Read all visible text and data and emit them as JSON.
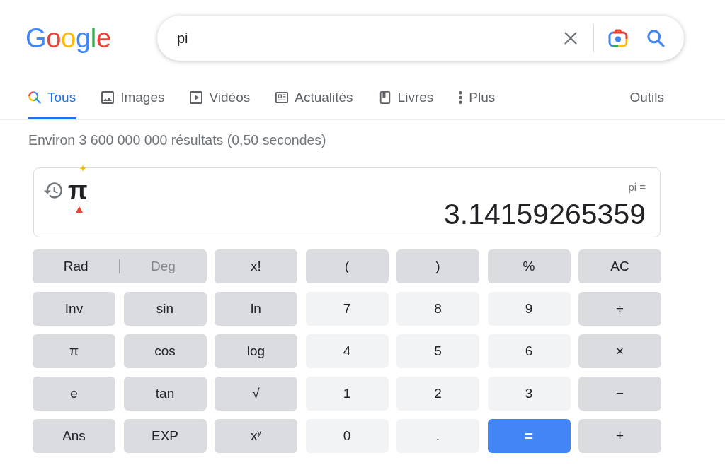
{
  "logo": "Google",
  "search": {
    "value": "pi"
  },
  "tabs": [
    {
      "label": "Tous",
      "kind": "search",
      "selected": true
    },
    {
      "label": "Images",
      "kind": "image",
      "selected": false
    },
    {
      "label": "Vidéos",
      "kind": "video",
      "selected": false
    },
    {
      "label": "Actualités",
      "kind": "news",
      "selected": false
    },
    {
      "label": "Livres",
      "kind": "book",
      "selected": false
    },
    {
      "label": "Plus",
      "kind": "more",
      "selected": false
    }
  ],
  "tools": "Outils",
  "result_stats": "Environ 3 600 000 000 résultats (0,50 secondes)",
  "calculator": {
    "expression": "π",
    "equation": "pi =",
    "result": "3.14159265359",
    "keys": [
      [
        {
          "kind": "toggle",
          "options": [
            {
              "label": "Rad",
              "selected": true
            },
            {
              "label": "Deg",
              "selected": false
            }
          ]
        },
        {
          "kind": "function",
          "label": "x!"
        },
        {
          "kind": "function",
          "label": "("
        },
        {
          "kind": "function",
          "label": ")"
        },
        {
          "kind": "function",
          "label": "%"
        },
        {
          "kind": "function",
          "label": "AC"
        }
      ],
      [
        {
          "kind": "function",
          "label": "Inv"
        },
        {
          "kind": "function",
          "label": "sin"
        },
        {
          "kind": "function",
          "label": "ln"
        },
        {
          "kind": "digit",
          "label": "7"
        },
        {
          "kind": "digit",
          "label": "8"
        },
        {
          "kind": "digit",
          "label": "9"
        },
        {
          "kind": "function",
          "label": "÷"
        }
      ],
      [
        {
          "kind": "function",
          "label": "π"
        },
        {
          "kind": "function",
          "label": "cos"
        },
        {
          "kind": "function",
          "label": "log"
        },
        {
          "kind": "digit",
          "label": "4"
        },
        {
          "kind": "digit",
          "label": "5"
        },
        {
          "kind": "digit",
          "label": "6"
        },
        {
          "kind": "function",
          "label": "×"
        }
      ],
      [
        {
          "kind": "function",
          "label": "e"
        },
        {
          "kind": "function",
          "label": "tan"
        },
        {
          "kind": "function",
          "label": "√"
        },
        {
          "kind": "digit",
          "label": "1"
        },
        {
          "kind": "digit",
          "label": "2"
        },
        {
          "kind": "digit",
          "label": "3"
        },
        {
          "kind": "function",
          "label": "−"
        }
      ],
      [
        {
          "kind": "function",
          "label": "Ans"
        },
        {
          "kind": "function",
          "label": "EXP"
        },
        {
          "kind": "function",
          "label": "x$^{y}$"
        },
        {
          "kind": "digit",
          "label": "0"
        },
        {
          "kind": "digit",
          "label": "."
        },
        {
          "kind": "equals",
          "label": "="
        },
        {
          "kind": "function",
          "label": "+"
        }
      ]
    ]
  }
}
